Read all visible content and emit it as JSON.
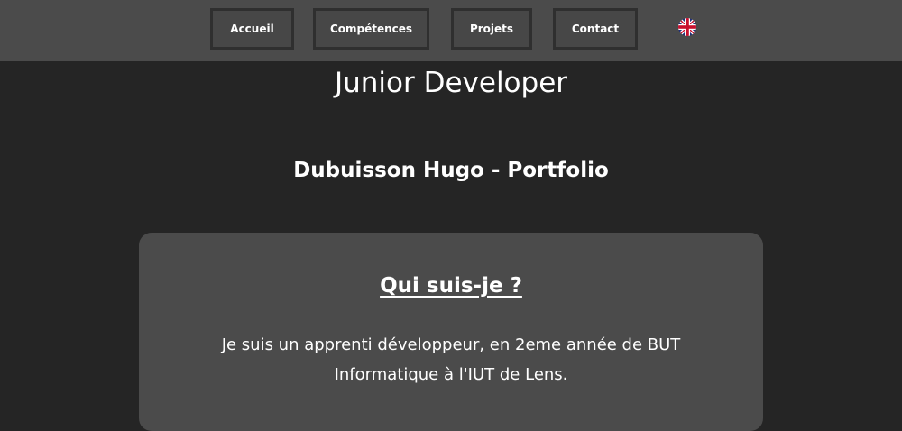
{
  "nav": {
    "items": [
      {
        "label": "Accueil"
      },
      {
        "label": "Compétences"
      },
      {
        "label": "Projets"
      },
      {
        "label": "Contact"
      }
    ],
    "language_icon": "uk-flag-icon"
  },
  "hero": {
    "title": "Junior Developer",
    "subtitle": "Dubuisson Hugo - Portfolio"
  },
  "about": {
    "heading": "Qui suis-je ?",
    "text": "Je suis un apprenti développeur, en 2eme année de BUT Informatique à l'IUT de Lens."
  },
  "colors": {
    "page_background": "#252525",
    "navbar_background": "#4b4b4b",
    "card_background": "#4b4b4b",
    "text": "#ffffff"
  }
}
